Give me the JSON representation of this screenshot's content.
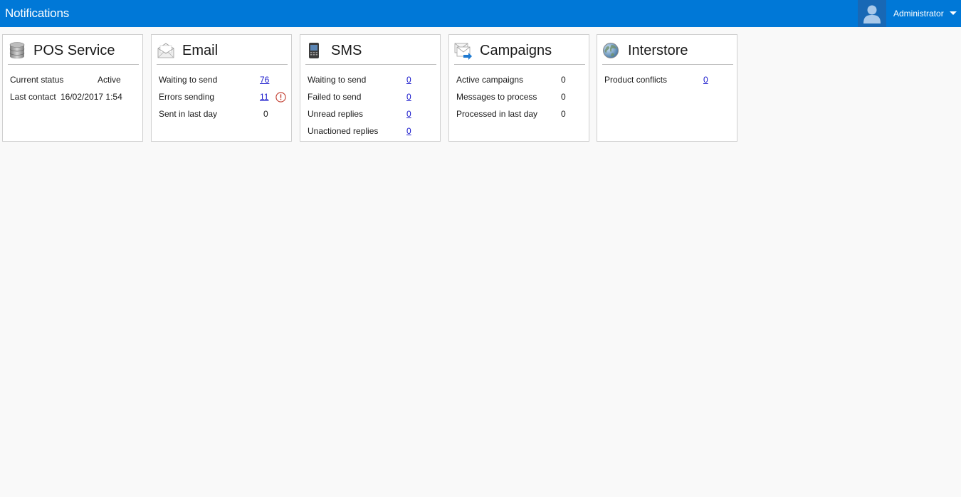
{
  "header": {
    "title": "Notifications",
    "user_name": "Administrator",
    "user_icon": "user-avatar-icon",
    "dropdown_icon": "chevron-down-icon"
  },
  "colors": {
    "topbar": "#0078d7",
    "link": "#1a1acc",
    "error": "#c0392b"
  },
  "cards": {
    "pos": {
      "title": "POS Service",
      "icon": "database-icon",
      "rows": [
        {
          "label": "Current status",
          "value": "Active"
        },
        {
          "label": "Last contact",
          "value": "16/02/2017 1:54"
        }
      ]
    },
    "email": {
      "title": "Email",
      "icon": "envelope-icon",
      "rows": [
        {
          "label": "Waiting to send",
          "value": "76"
        },
        {
          "label": "Errors sending",
          "value": "11",
          "alert_icon": "error-alert-icon"
        },
        {
          "label": "Sent in last day",
          "value": "0"
        }
      ]
    },
    "sms": {
      "title": "SMS",
      "icon": "mobile-phone-icon",
      "rows": [
        {
          "label": "Waiting to send",
          "value": "0"
        },
        {
          "label": "Failed to send",
          "value": "0"
        },
        {
          "label": "Unread replies",
          "value": "0"
        },
        {
          "label": "Unactioned replies",
          "value": "0"
        }
      ]
    },
    "campaigns": {
      "title": "Campaigns",
      "icon": "campaign-send-icon",
      "rows": [
        {
          "label": "Active campaigns",
          "value": "0"
        },
        {
          "label": "Messages to process",
          "value": "0"
        },
        {
          "label": "Processed in last day",
          "value": "0"
        }
      ]
    },
    "interstore": {
      "title": "Interstore",
      "icon": "globe-icon",
      "rows": [
        {
          "label": "Product conflicts",
          "value": "0"
        }
      ]
    }
  }
}
